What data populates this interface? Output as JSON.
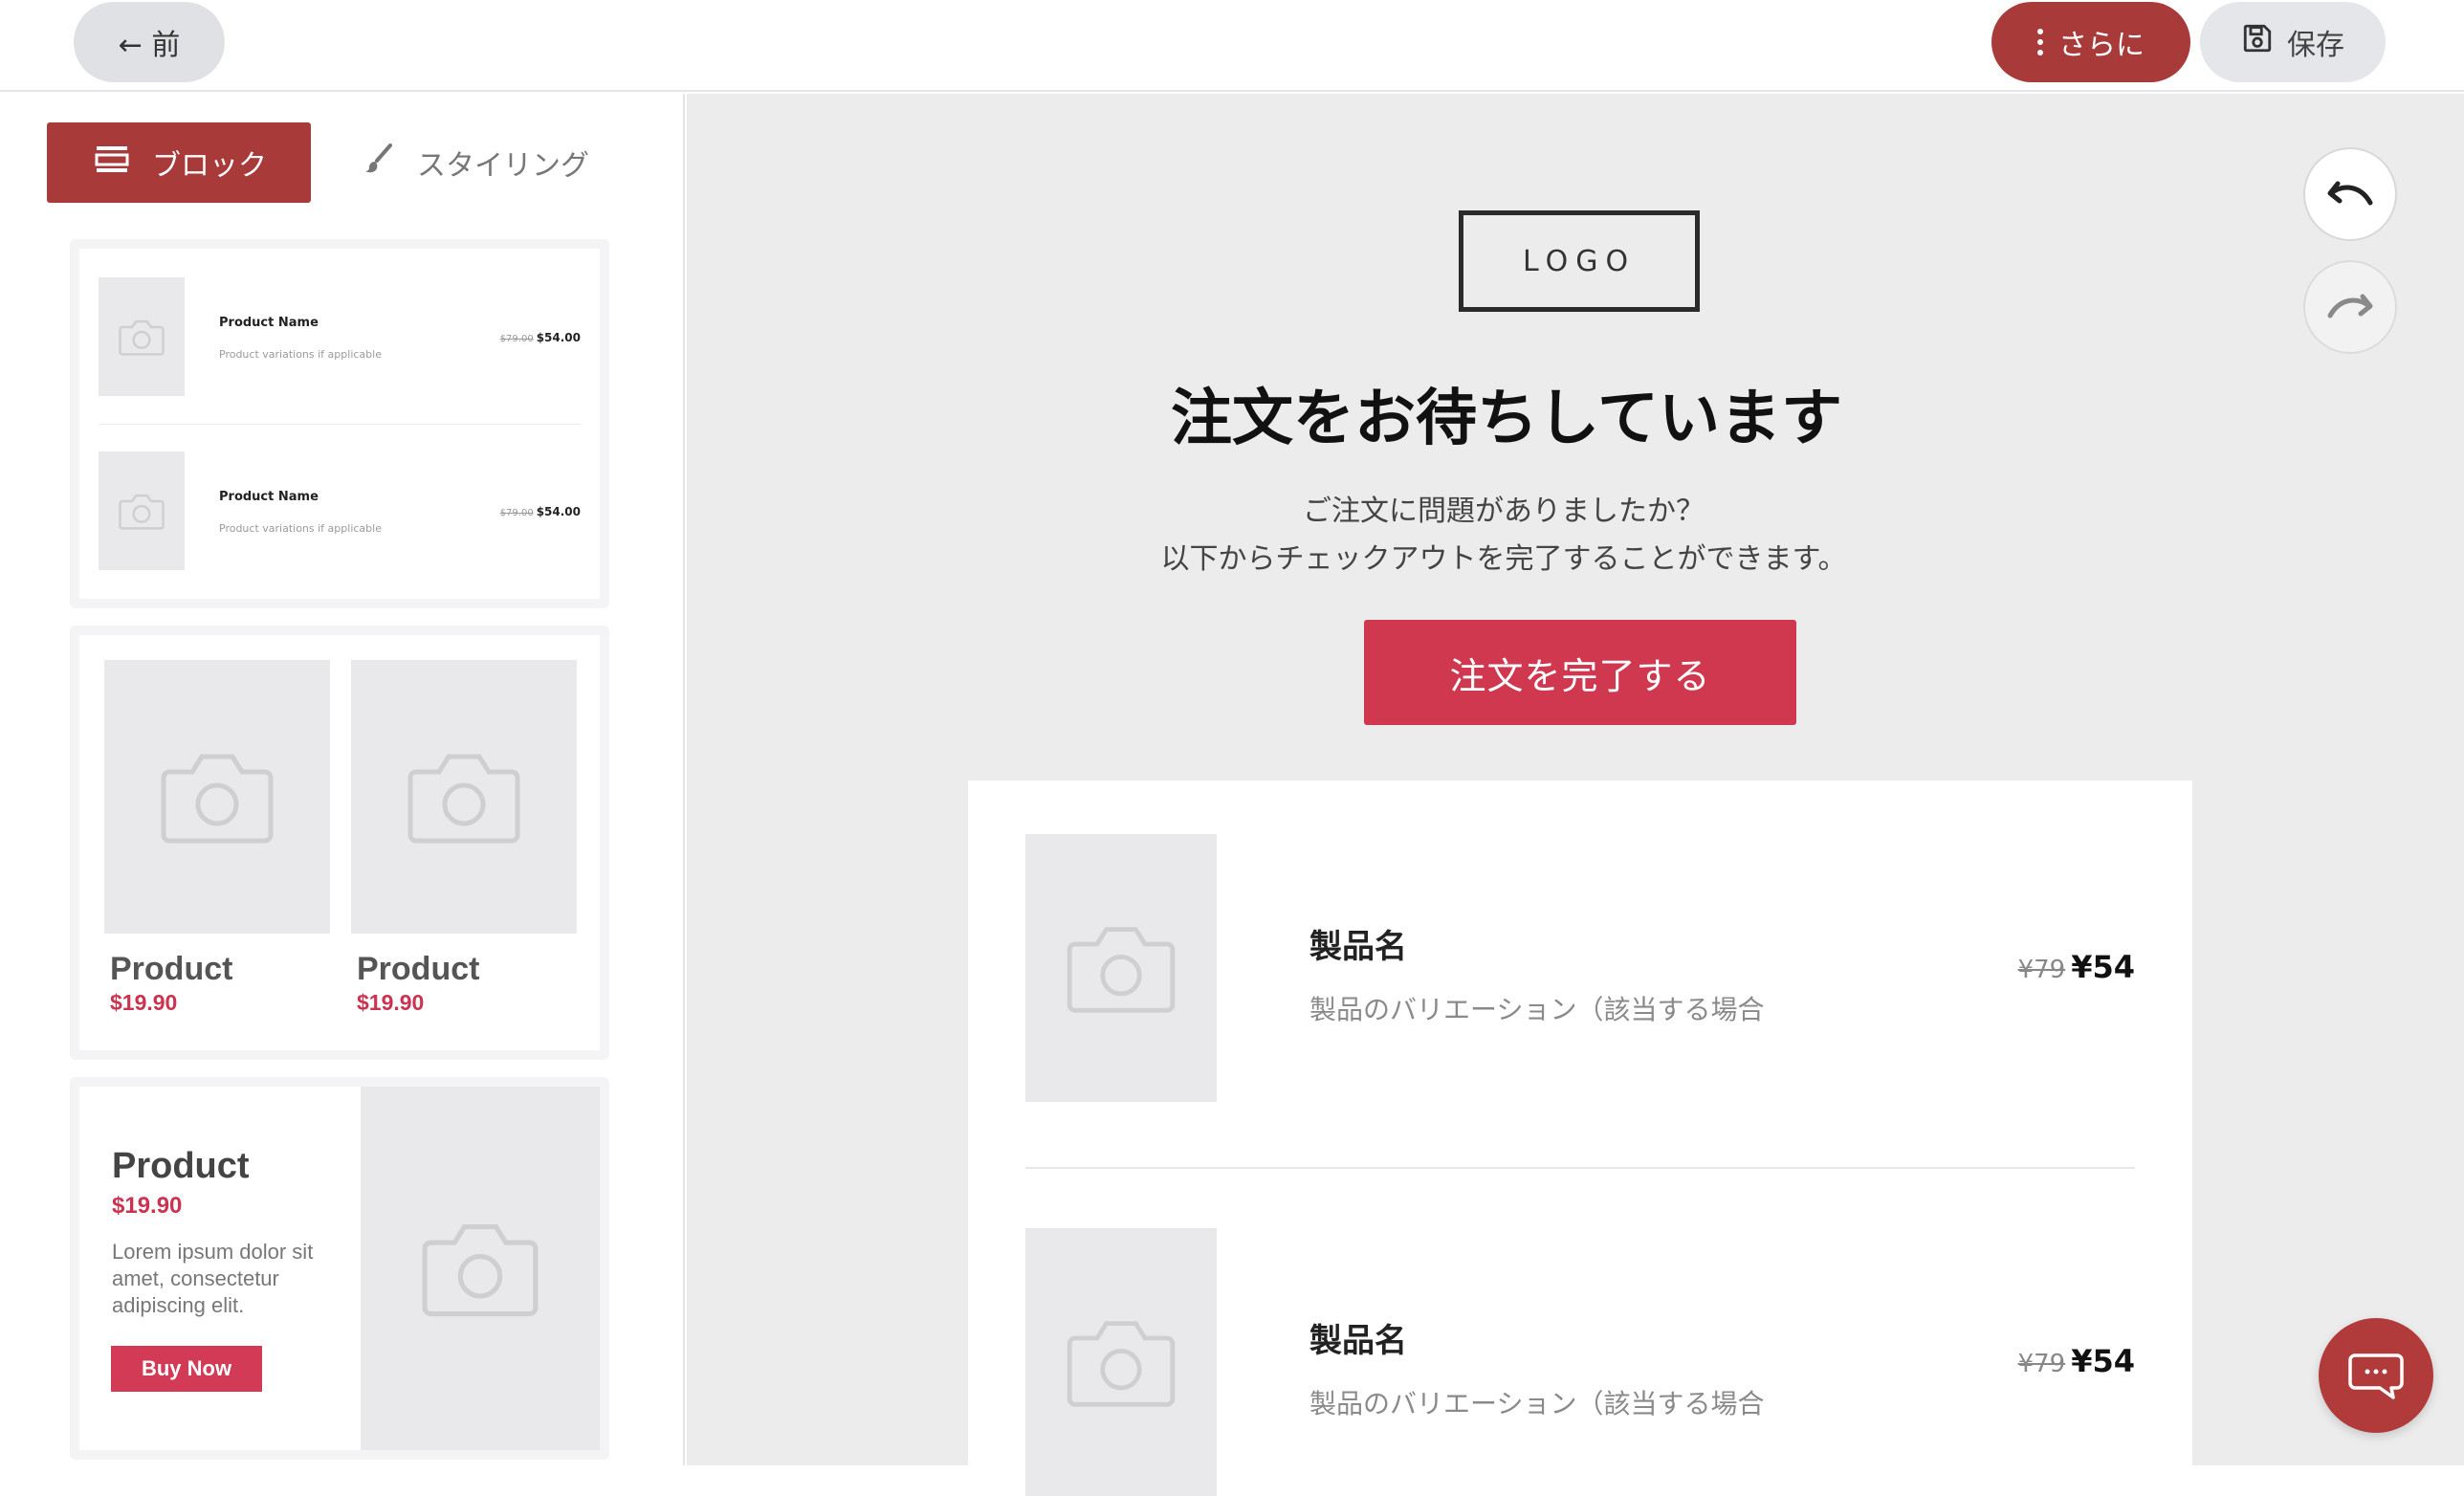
{
  "topbar": {
    "back_label": "← 前",
    "more_label": "さらに",
    "save_label": "保存"
  },
  "sidebar": {
    "tabs": [
      {
        "label": "ブロック",
        "icon": "blocks-icon",
        "active": true
      },
      {
        "label": "スタイリング",
        "icon": "brush-icon",
        "active": false
      }
    ],
    "cart_block": {
      "rows": [
        {
          "name": "Product Name",
          "variation": "Product variations if applicable",
          "old_price": "$79.00",
          "price": "$54.00"
        },
        {
          "name": "Product Name",
          "variation": "Product variations if applicable",
          "old_price": "$79.00",
          "price": "$54.00"
        }
      ]
    },
    "grid_block": {
      "items": [
        {
          "title": "Product",
          "price": "$19.90"
        },
        {
          "title": "Product",
          "price": "$19.90"
        }
      ]
    },
    "feature_block": {
      "title": "Product",
      "price": "$19.90",
      "description": "Lorem ipsum dolor sit amet, consectetur adipiscing elit.",
      "button": "Buy Now"
    }
  },
  "email": {
    "logo": "LOGO",
    "headline": "注文をお待ちしています",
    "subtext_line1": "ご注文に問題がありましたか？",
    "subtext_line2": "以下からチェックアウトを完了することができます。",
    "cta": "注文を完了する",
    "items": [
      {
        "name": "製品名",
        "variation": "製品のバリエーション（該当する場合",
        "old_price": "¥79",
        "price": "¥54"
      },
      {
        "name": "製品名",
        "variation": "製品のバリエーション（該当する場合",
        "old_price": "¥79",
        "price": "¥54"
      }
    ]
  },
  "colors": {
    "accent": "#a83a3a",
    "cta": "#d0384f",
    "price_red": "#cc3350"
  }
}
